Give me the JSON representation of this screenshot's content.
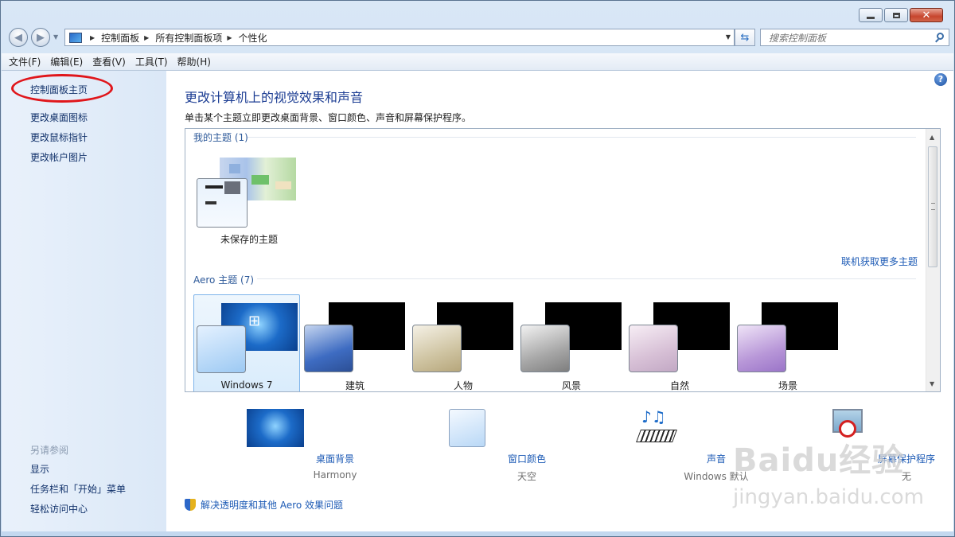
{
  "window": {
    "controls": {
      "minimize": "minimize-icon",
      "maximize": "maximize-icon",
      "close": "close-icon"
    }
  },
  "address_bar": {
    "crumbs": [
      "控制面板",
      "所有控制面板项",
      "个性化"
    ],
    "search_placeholder": "搜索控制面板"
  },
  "menu": [
    "文件(F)",
    "编辑(E)",
    "查看(V)",
    "工具(T)",
    "帮助(H)"
  ],
  "left_pane": {
    "tasks": [
      "控制面板主页",
      "更改桌面图标",
      "更改鼠标指针",
      "更改帐户图片"
    ],
    "see_also_heading": "另请参阅",
    "see_also": [
      "显示",
      "任务栏和「开始」菜单",
      "轻松访问中心"
    ]
  },
  "main": {
    "heading": "更改计算机上的视觉效果和声音",
    "subtitle": "单击某个主题立即更改桌面背景、窗口颜色、声音和屏幕保护程序。",
    "my_themes_label": "我的主题 (1)",
    "unsaved_theme": "未保存的主题",
    "online_link": "联机获取更多主题",
    "aero_label": "Aero 主题 (7)",
    "aero_themes": [
      {
        "name": "Windows 7",
        "selected": true
      },
      {
        "name": "建筑",
        "selected": false
      },
      {
        "name": "人物",
        "selected": false
      },
      {
        "name": "风景",
        "selected": false
      },
      {
        "name": "自然",
        "selected": false
      },
      {
        "name": "场景",
        "selected": false
      }
    ],
    "settings": [
      {
        "title": "桌面背景",
        "value": "Harmony"
      },
      {
        "title": "窗口颜色",
        "value": "天空"
      },
      {
        "title": "声音",
        "value": "Windows 默认"
      },
      {
        "title": "屏幕保护程序",
        "value": "无"
      }
    ],
    "troubleshoot": "解决透明度和其他 Aero 效果问题"
  },
  "watermark": {
    "brand": "Baidu经验",
    "url": "jingyan.baidu.com"
  }
}
